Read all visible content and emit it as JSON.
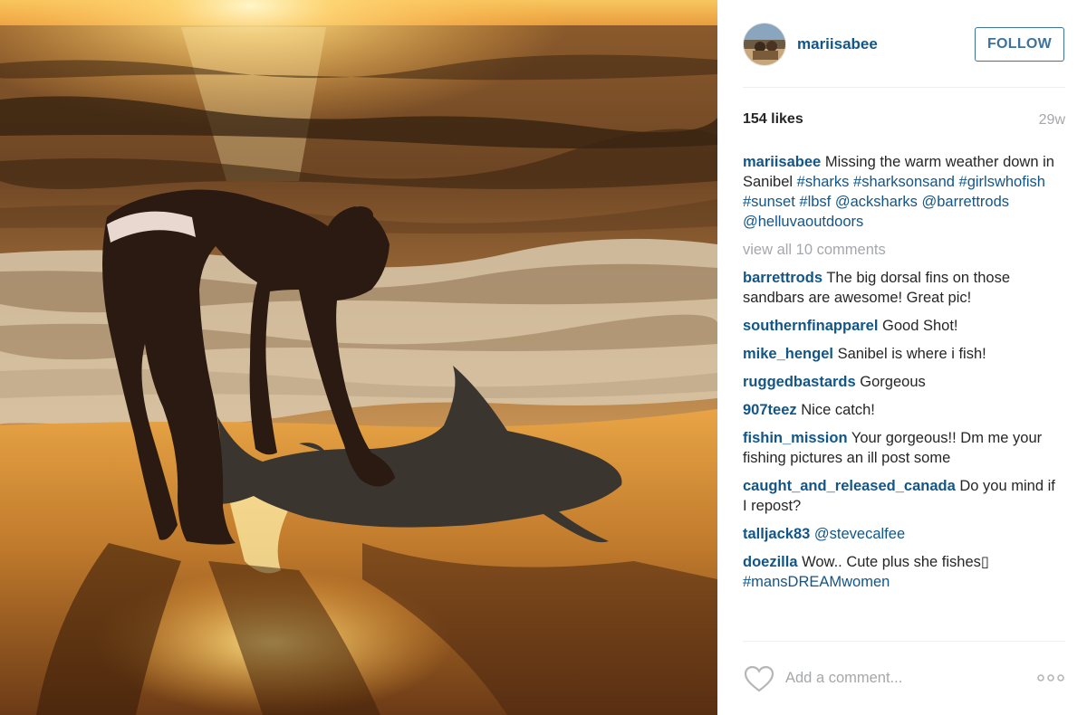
{
  "post": {
    "username": "mariisabee",
    "follow_label": "FOLLOW",
    "likes": "154 likes",
    "age": "29w",
    "caption": {
      "user": "mariisabee",
      "text": "Missing the warm weather down in Sanibel",
      "tags": [
        "#sharks",
        "#sharksonsand",
        "#girlswhofish",
        "#sunset",
        "#lbsf",
        "@acksharks",
        "@barrettrods",
        "@helluvaoutdoors"
      ]
    },
    "view_all_comments": "view all 10 comments",
    "comments": [
      {
        "user": "barrettrods",
        "text": "The big dorsal fins on those sandbars are awesome! Great pic!"
      },
      {
        "user": "southernfinapparel",
        "text": "Good Shot!"
      },
      {
        "user": "mike_hengel",
        "text": "Sanibel is where i fish!"
      },
      {
        "user": "ruggedbastards",
        "text": "Gorgeous"
      },
      {
        "user": "907teez",
        "text": "Nice catch!"
      },
      {
        "user": "fishin_mission",
        "text": "Your gorgeous!! Dm me your fishing pictures an ill post some"
      },
      {
        "user": "caught_and_released_canada",
        "text": "Do you mind if I repost?"
      },
      {
        "user": "talljack83",
        "text": "",
        "mention": "@stevecalfee"
      },
      {
        "user": "doezilla",
        "text": "Wow.. Cute plus she fishes▯",
        "tag": "#mansDREAMwomen"
      }
    ],
    "add_comment_placeholder": "Add a comment...",
    "icons": {
      "like": "heart-outline-icon",
      "more": "ellipsis-icon"
    }
  },
  "colors": {
    "link_blue": "#125688",
    "follow_blue": "#3f729b",
    "muted_gray": "#a5a7aa",
    "divider": "#efefef"
  }
}
